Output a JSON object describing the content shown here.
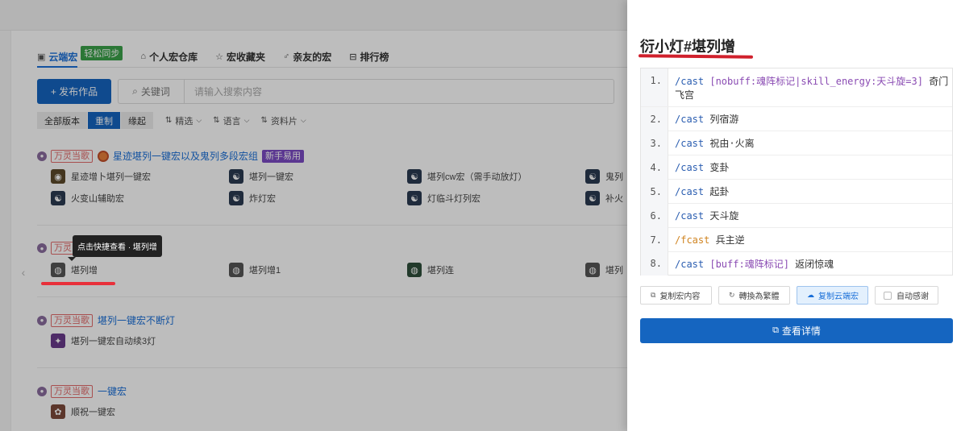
{
  "tabs": [
    {
      "icon": "cloud-macro-icon",
      "label": "云端宏",
      "badge": "轻松同步"
    },
    {
      "icon": "personal-repo-icon",
      "label": "个人宏仓库"
    },
    {
      "icon": "star-icon",
      "label": "宏收藏夹"
    },
    {
      "icon": "friends-icon",
      "label": "亲友的宏"
    },
    {
      "icon": "ranking-icon",
      "label": "排行榜"
    }
  ],
  "toolbar": {
    "publish_label": "+ 发布作品",
    "keyword_label": "关键词",
    "search_placeholder": "请输入搜索内容"
  },
  "filters": {
    "segments": [
      "全部版本",
      "重制",
      "缘起"
    ],
    "dropdowns": [
      "精选",
      "语言",
      "资料片"
    ]
  },
  "groups": [
    {
      "author_tag": "万灵当歌",
      "title": "星迹堪列一键宏以及鬼列多段宏组",
      "badge": "新手易用",
      "items": [
        "星迹增卜堪列一键宏",
        "堪列一键宏",
        "堪列cw宏（需手动放灯）",
        "鬼列",
        "火变山辅助宏",
        "炸灯宏",
        "灯临斗灯列宏",
        "补火"
      ]
    },
    {
      "author_tag": "万灵",
      "title": "",
      "items": [
        "堪列增",
        "堪列增1",
        "堪列连",
        "堪列"
      ]
    },
    {
      "author_tag": "万灵当歌",
      "title": "堪列一键宏不断灯",
      "items": [
        "堪列一键宏自动续3灯"
      ]
    },
    {
      "author_tag": "万灵当歌",
      "title": "一键宏",
      "items": [
        "顺祝一键宏"
      ]
    }
  ],
  "tooltip": "点击快捷查看 · 堪列增",
  "drawer": {
    "title": "衍小灯#堪列增",
    "lines": [
      {
        "num": "1.",
        "cmd": "/cast",
        "cond": "[nobuff:魂阵标记|skill_energy:天斗旋=3]",
        "arg": "奇门飞宫"
      },
      {
        "num": "2.",
        "cmd": "/cast",
        "cond": "",
        "arg": "列宿游"
      },
      {
        "num": "3.",
        "cmd": "/cast",
        "cond": "",
        "arg": "祝由·火离"
      },
      {
        "num": "4.",
        "cmd": "/cast",
        "cond": "",
        "arg": "变卦"
      },
      {
        "num": "5.",
        "cmd": "/cast",
        "cond": "",
        "arg": "起卦"
      },
      {
        "num": "6.",
        "cmd": "/cast",
        "cond": "",
        "arg": "天斗旋"
      },
      {
        "num": "7.",
        "cmd": "/fcast",
        "cond": "",
        "arg": "兵主逆"
      },
      {
        "num": "8.",
        "cmd": "/cast",
        "cond": "[buff:魂阵标记]",
        "arg": "返闭惊魂"
      }
    ],
    "buttons": {
      "copy_content": "复制宏内容",
      "convert_traditional": "轉換為繁體",
      "copy_cloud": "复制云端宏",
      "auto_thanks": "自动感谢"
    },
    "detail_label": "查看详情"
  }
}
